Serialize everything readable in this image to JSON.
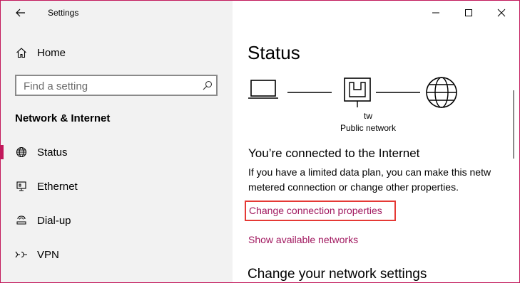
{
  "window": {
    "title": "Settings",
    "controls": [
      "minimize",
      "maximize",
      "close"
    ]
  },
  "sidebar": {
    "home_label": "Home",
    "search": {
      "placeholder": "Find a setting",
      "value": ""
    },
    "section_heading": "Network & Internet",
    "items": [
      {
        "label": "Status",
        "icon": "globe-icon",
        "active": true
      },
      {
        "label": "Ethernet",
        "icon": "ethernet-icon",
        "active": false
      },
      {
        "label": "Dial-up",
        "icon": "dialup-icon",
        "active": false
      },
      {
        "label": "VPN",
        "icon": "vpn-icon",
        "active": false
      }
    ]
  },
  "main": {
    "title": "Status",
    "network": {
      "name": "tw",
      "type": "Public network"
    },
    "connection_heading": "You’re connected to the Internet",
    "description_line1": "If you have a limited data plan, you can make this netw",
    "description_line2": "metered connection or change other properties.",
    "change_properties_link": "Change connection properties",
    "show_networks_link": "Show available networks",
    "settings_heading": "Change your network settings"
  },
  "colors": {
    "accent": "#c2185b",
    "link": "#a1185f",
    "highlight_border": "#e53935",
    "sidebar_bg": "#f2f2f2"
  }
}
